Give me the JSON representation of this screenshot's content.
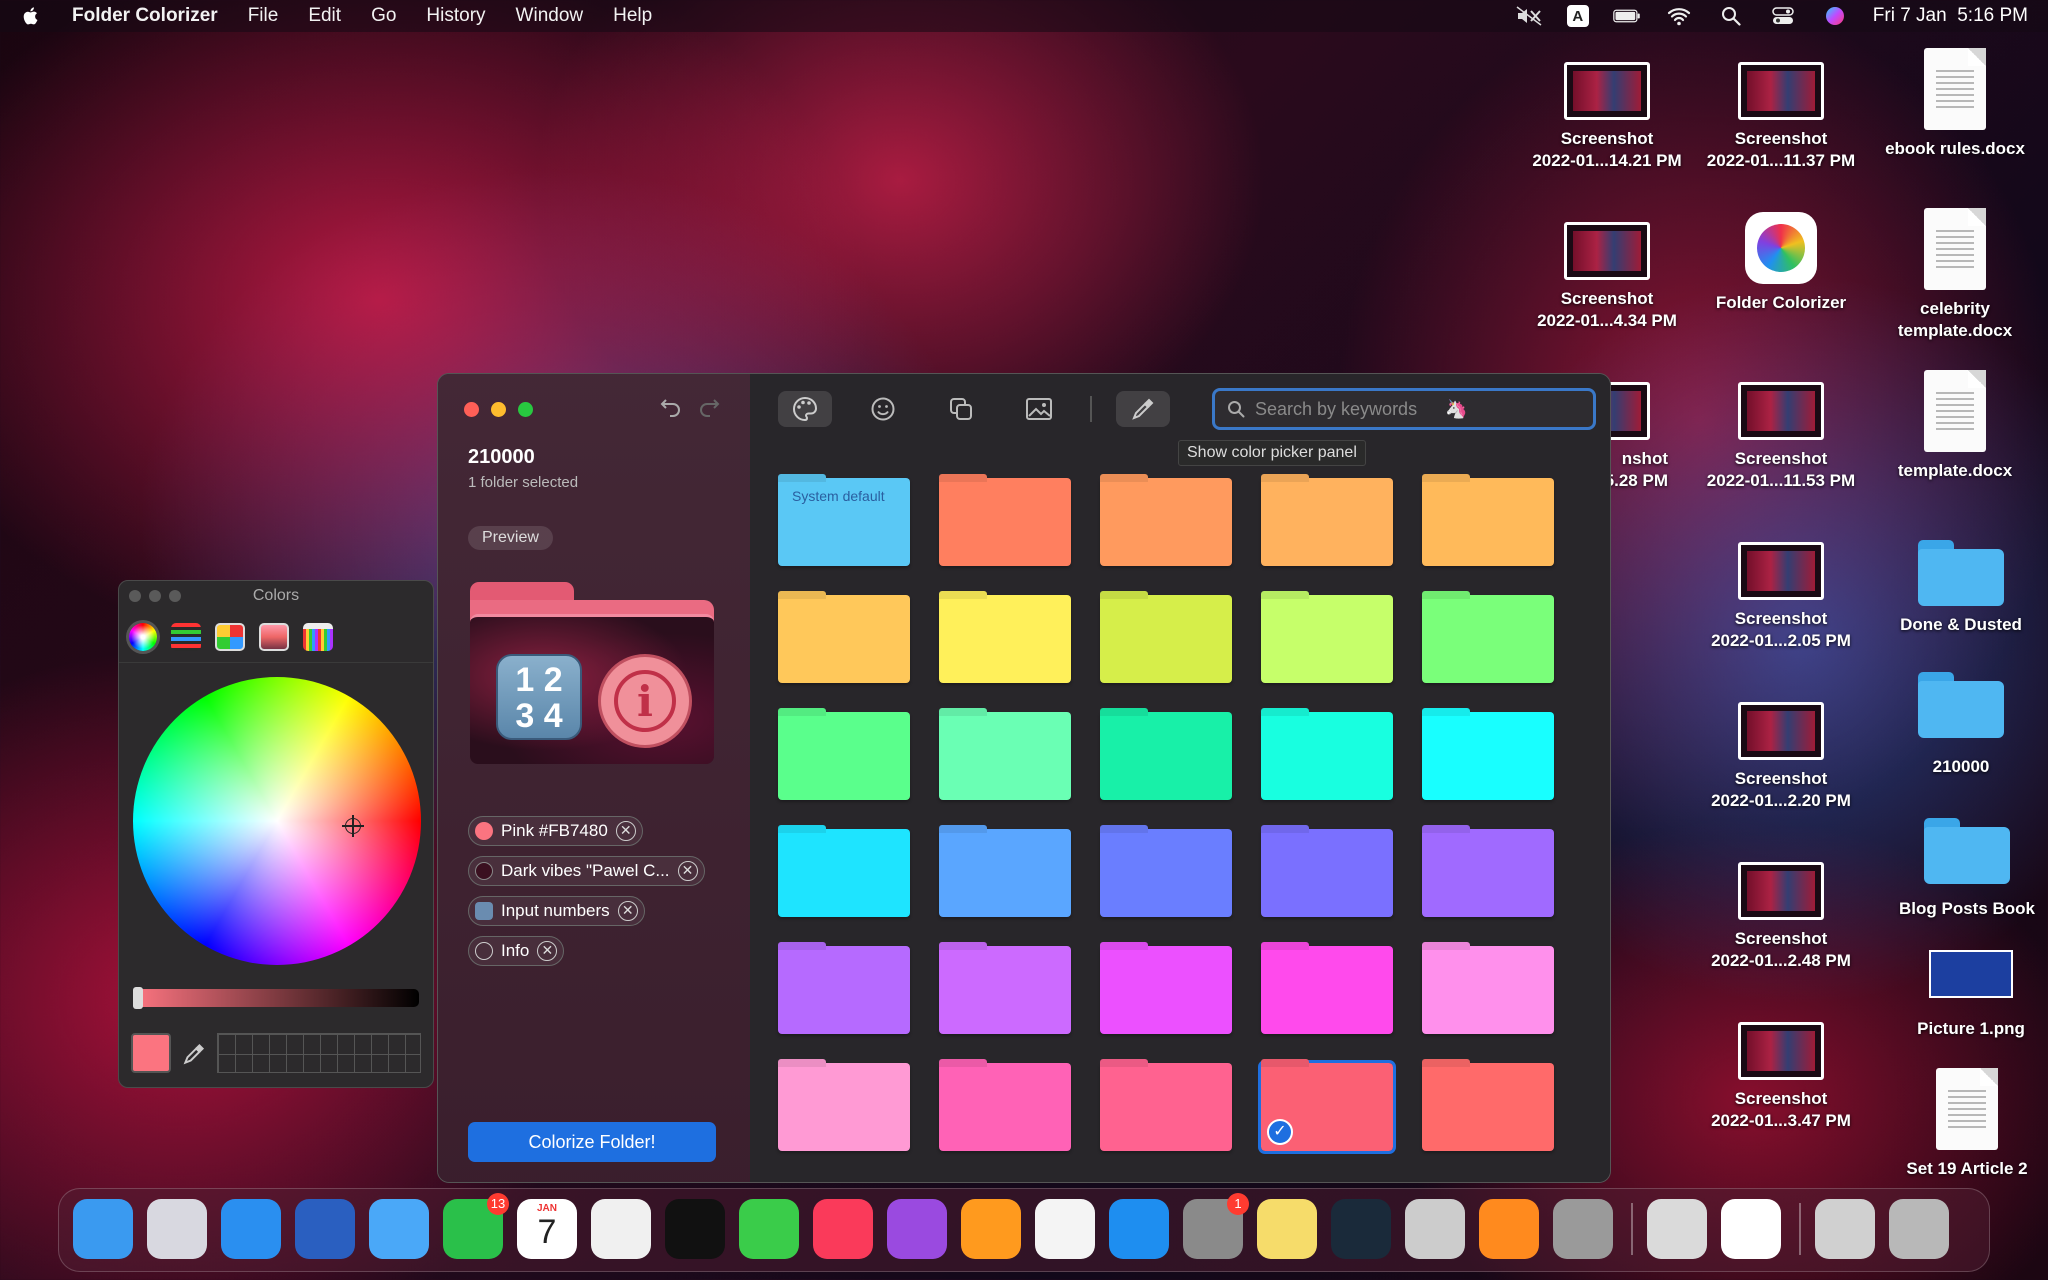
{
  "menubar": {
    "app_name": "Folder Colorizer",
    "items": [
      "File",
      "Edit",
      "Go",
      "History",
      "Window",
      "Help"
    ],
    "keyboard_indicator": "A",
    "datetime": "Fri 7 Jan  5:16 PM"
  },
  "desktop": {
    "icons": [
      {
        "label": "Screenshot\n2022-01...14.21 PM",
        "kind": "screenshot"
      },
      {
        "label": "Screenshot\n2022-01...11.37 PM",
        "kind": "screenshot"
      },
      {
        "label": "ebook rules.docx",
        "kind": "doc"
      },
      {
        "label": "Screenshot\n2022-01...4.34 PM",
        "kind": "screenshot"
      },
      {
        "label": "Folder Colorizer",
        "kind": "app"
      },
      {
        "label": "celebrity\ntemplate.docx",
        "kind": "doc"
      },
      {
        "label": "nshot\n.5.28 PM",
        "kind": "screenshot"
      },
      {
        "label": "Screenshot\n2022-01...11.53 PM",
        "kind": "screenshot"
      },
      {
        "label": "template.docx",
        "kind": "doc"
      },
      {
        "label": "Screenshot\n2022-01...2.05 PM",
        "kind": "screenshot"
      },
      {
        "label": "Done & Dusted",
        "kind": "folder"
      },
      {
        "label": "Screenshot\n2022-01...2.20 PM",
        "kind": "screenshot"
      },
      {
        "label": "210000",
        "kind": "folder"
      },
      {
        "label": "Screenshot\n2022-01...2.48 PM",
        "kind": "screenshot"
      },
      {
        "label": "Blog Posts Book",
        "kind": "folder"
      },
      {
        "label": "Picture 1.png",
        "kind": "picture"
      },
      {
        "label": "Screenshot\n2022-01...3.47 PM",
        "kind": "screenshot"
      },
      {
        "label": "Set 19 Article 2",
        "kind": "doc"
      }
    ]
  },
  "colors_panel": {
    "title": "Colors",
    "current_color": "#FB7480"
  },
  "window": {
    "folder_name": "210000",
    "selection": "1 folder selected",
    "preview_label": "Preview",
    "preview_numbers": "1 2\n3 4",
    "preview_info_glyph": "i",
    "tags": [
      {
        "label": "Pink #FB7480",
        "dot_color": "#FB7480",
        "remove": "✕"
      },
      {
        "label": "Dark vibes \"Pawel C...",
        "dot_color": "#3a1020",
        "remove": "✕"
      },
      {
        "label": "Input numbers",
        "dot_color": "#6a8cb0",
        "remove": "✕"
      },
      {
        "label": "Info",
        "dot_color": "transparent",
        "remove": "✕"
      }
    ],
    "colorize_button": "Colorize Folder!",
    "search_placeholder": "Search by keywords",
    "search_emoji": "🦄",
    "tooltip": "Show color picker panel",
    "system_default_label": "System default",
    "swatches": [
      [
        "#5ac8f5",
        "#ff7f5f",
        "#ff9a5e",
        "#ffb25e",
        "#ffba5a"
      ],
      [
        "#ffc85a",
        "#fff05a",
        "#d6ee4a",
        "#c6ff6a",
        "#7aff7a"
      ],
      [
        "#5aff8c",
        "#6affb4",
        "#18f0a8",
        "#18ffe0",
        "#18ffff"
      ],
      [
        "#1ee4ff",
        "#5aa6ff",
        "#6a7eff",
        "#7a70ff",
        "#a06aff"
      ],
      [
        "#b66aff",
        "#cc6aff",
        "#ec50ff",
        "#ff4aec",
        "#ff90ec"
      ],
      [
        "#ff9ad4",
        "#ff62b6",
        "#ff6290",
        "#fb6074",
        "#ff6a6a"
      ]
    ],
    "selected_swatch": {
      "row": 5,
      "col": 3
    },
    "check_glyph": "✓"
  },
  "dock": {
    "items": [
      {
        "name": "finder",
        "color": "#3a9af0"
      },
      {
        "name": "launchpad",
        "color": "#d8d8e0"
      },
      {
        "name": "safari",
        "color": "#2a8ff0"
      },
      {
        "name": "word",
        "color": "#2a5fc0"
      },
      {
        "name": "mail",
        "color": "#4aa8f8"
      },
      {
        "name": "facetime",
        "color": "#2ac04a",
        "badge": "13"
      },
      {
        "name": "calendar",
        "color": "#ffffff",
        "month": "JAN",
        "day": "7"
      },
      {
        "name": "chrome",
        "color": "#f0f0f0"
      },
      {
        "name": "apple-tv",
        "color": "#111111"
      },
      {
        "name": "messages",
        "color": "#3acc4a"
      },
      {
        "name": "music",
        "color": "#fa3a5a"
      },
      {
        "name": "podcasts",
        "color": "#9a4ae0"
      },
      {
        "name": "books",
        "color": "#ff9a1e"
      },
      {
        "name": "script-editor",
        "color": "#f4f4f4"
      },
      {
        "name": "app-store",
        "color": "#1e8ef0"
      },
      {
        "name": "system-preferences",
        "color": "#8a8a8a",
        "badge": "1"
      },
      {
        "name": "stickies",
        "color": "#f6dc6a"
      },
      {
        "name": "league-of-legends",
        "color": "#1a2a3a"
      },
      {
        "name": "automator",
        "color": "#cccccc"
      },
      {
        "name": "vlc",
        "color": "#ff8a1e"
      },
      {
        "name": "calculator",
        "color": "#9a9a9a"
      },
      {
        "name": "preview",
        "color": "#dadada"
      },
      {
        "name": "folder-colorizer",
        "color": "#ffffff"
      },
      {
        "name": "downloads",
        "color": "#d0d0d0"
      },
      {
        "name": "trash",
        "color": "#b8b8b8"
      }
    ]
  }
}
